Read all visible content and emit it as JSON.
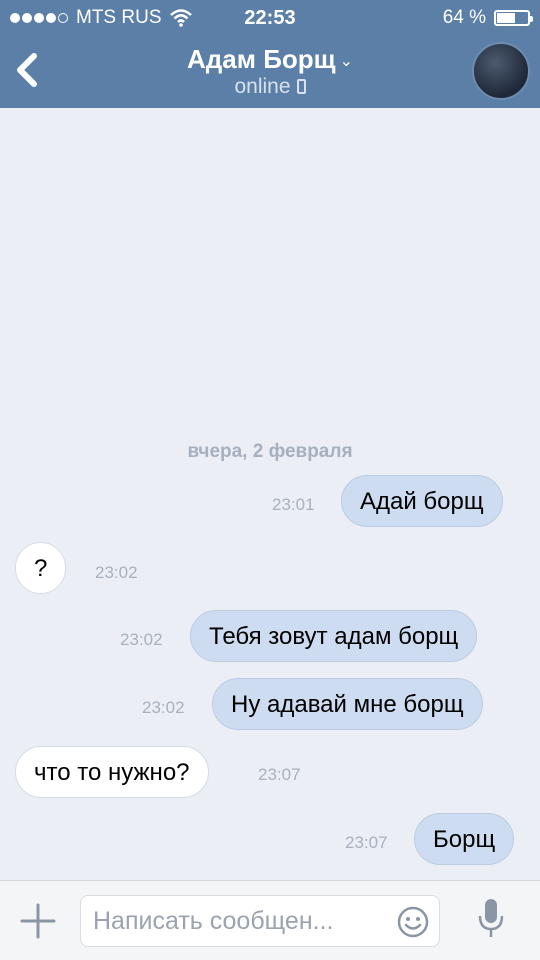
{
  "status_bar": {
    "carrier": "MTS RUS",
    "time": "22:53",
    "battery_text": "64 %",
    "battery_level": 0.64,
    "signal_bars": 4,
    "signal_total": 5
  },
  "header": {
    "contact_name": "Адам Борщ",
    "chevron": "⌄",
    "status": "online",
    "icons": [
      "back-chevron-icon",
      "mobile-phone-icon",
      "avatar"
    ]
  },
  "chat": {
    "date_separator": "вчера, 2 февраля",
    "messages": [
      {
        "direction": "out",
        "text": "Адай борщ",
        "time": "23:01"
      },
      {
        "direction": "in",
        "text": "?",
        "time": "23:02"
      },
      {
        "direction": "out",
        "text": "Тебя зовут адам борщ",
        "time": "23:02"
      },
      {
        "direction": "out",
        "text": "Ну адавай мне борщ",
        "time": "23:02"
      },
      {
        "direction": "in",
        "text": "что то нужно?",
        "time": "23:07"
      },
      {
        "direction": "out",
        "text": "Борщ",
        "time": "23:07"
      }
    ]
  },
  "composer": {
    "placeholder": "Написать сообщен...",
    "icons": [
      "plus-icon",
      "smile-icon",
      "microphone-icon"
    ]
  },
  "colors": {
    "header": "#5b7fa6",
    "background": "#ebeff5",
    "outgoing_bubble": "#cddcf0",
    "incoming_bubble": "#ffffff"
  }
}
